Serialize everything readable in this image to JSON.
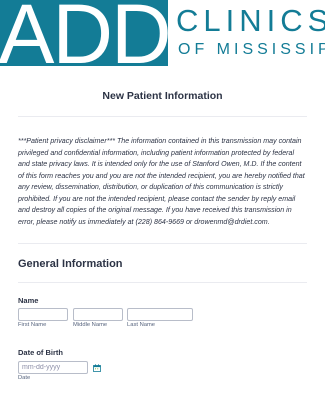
{
  "logo": {
    "monogram": "ADD",
    "line1": "CLINICS",
    "line2": "OF MISSISSIPPI",
    "brand_color": "#137c96"
  },
  "form": {
    "title": "New Patient Information",
    "disclaimer": "***Patient privacy disclaimer*** The information contained in this transmission may contain privileged and confidential information, including patient information protected by federal and state privacy laws. It is intended only for the use of Stanford Owen, M.D. If the content of this form reaches you and you are not the intended recipient, you are hereby notified that any review, dissemination, distribution, or duplication of this communication is strictly prohibited. If you are not the intended recipient, please contact the sender by reply email and destroy all copies of the original message. If you have received this transmission in error, please notify us immediately at (228) 864-9669 or drowenmd@drdiet.com."
  },
  "general": {
    "heading": "General Information",
    "name": {
      "label": "Name",
      "first_value": "",
      "middle_value": "",
      "last_value": "",
      "first_sublabel": "First Name",
      "middle_sublabel": "Middle Name",
      "last_sublabel": "Last Name"
    },
    "dob": {
      "label": "Date of Birth",
      "placeholder": "mm-dd-yyyy",
      "sublabel": "Date",
      "icon": "calendar-icon"
    }
  }
}
